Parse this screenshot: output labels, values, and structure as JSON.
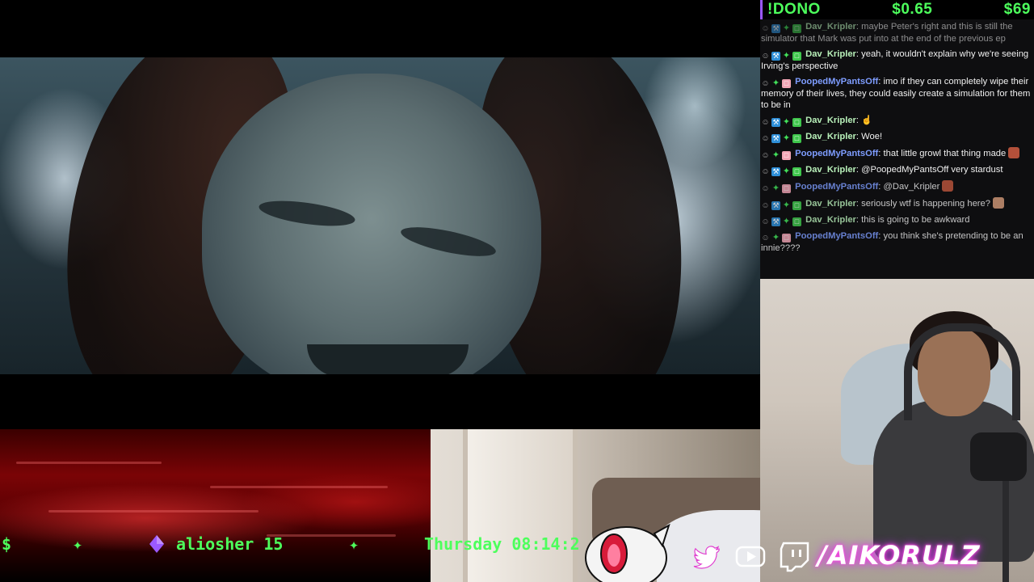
{
  "chat": {
    "dono_label": "!DONO",
    "dono_amount": "$0.65",
    "dono_total": "$69",
    "messages": [
      {
        "user": "Dav_Kripler",
        "text": "maybe Peter's right and this is still the simulator that Mark was put into at the end of the previous ep",
        "faded": true
      },
      {
        "user": "Dav_Kripler",
        "text": "yeah, it wouldn't explain why we're seeing Irving's perspective"
      },
      {
        "user": "PoopedMyPantsOff",
        "text": "imo if they can completely wipe their memory of their lives, they could easily create a simulation for them to be in"
      },
      {
        "user": "Dav_Kripler",
        "text": "☝"
      },
      {
        "user": "Dav_Kripler",
        "text": "Woe!"
      },
      {
        "user": "PoopedMyPantsOff",
        "text": "that little growl that thing made"
      },
      {
        "user": "Dav_Kripler",
        "text": "@PoopedMyPantsOff very stardust"
      },
      {
        "user": "PoopedMyPantsOff",
        "text": "@Dav_Kripler"
      },
      {
        "user": "Dav_Kripler",
        "text": "seriously wtf is happening here?"
      },
      {
        "user": "Dav_Kripler",
        "text": "this is going to be awkward"
      },
      {
        "user": "PoopedMyPantsOff",
        "text": "you think she's pretending to be an innie????"
      }
    ]
  },
  "ticker": {
    "dollar": "$",
    "star": "✦",
    "sub_name": "aliosher",
    "sub_count": "15",
    "time": "Thursday 08:14:2"
  },
  "brand": {
    "handle": "/AIKORULZ",
    "accent_green": "#4dff5c",
    "accent_pink": "#ff48d8",
    "accent_purple": "#9b59ff"
  },
  "icons": [
    "twitter-icon",
    "youtube-icon",
    "twitch-icon"
  ]
}
